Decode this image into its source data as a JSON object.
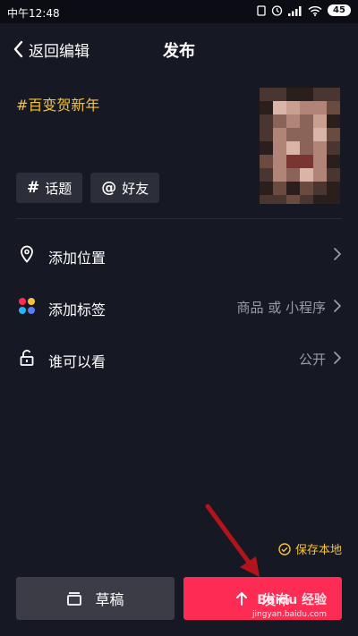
{
  "status_bar": {
    "time": "中午12:48",
    "battery": "45"
  },
  "header": {
    "back_label": "返回编辑",
    "title": "发布"
  },
  "caption": {
    "text": "#百变贺新年"
  },
  "chips": [
    {
      "symbol": "#",
      "label": "话题"
    },
    {
      "symbol": "@",
      "label": "好友"
    }
  ],
  "rows": [
    {
      "label": "添加位置",
      "value": ""
    },
    {
      "label": "添加标签",
      "value": "商品 或 小程序"
    },
    {
      "label": "谁可以看",
      "value": "公开"
    }
  ],
  "save_local": {
    "label": "保存本地"
  },
  "buttons": {
    "draft": "草稿",
    "publish": "发布"
  },
  "watermark": {
    "brand": "Baidu 经验",
    "url": "jingyan.baidu.com"
  },
  "colors": {
    "background": "#161823",
    "accent": "#fe2c55",
    "hashtag": "#f7c23b"
  }
}
